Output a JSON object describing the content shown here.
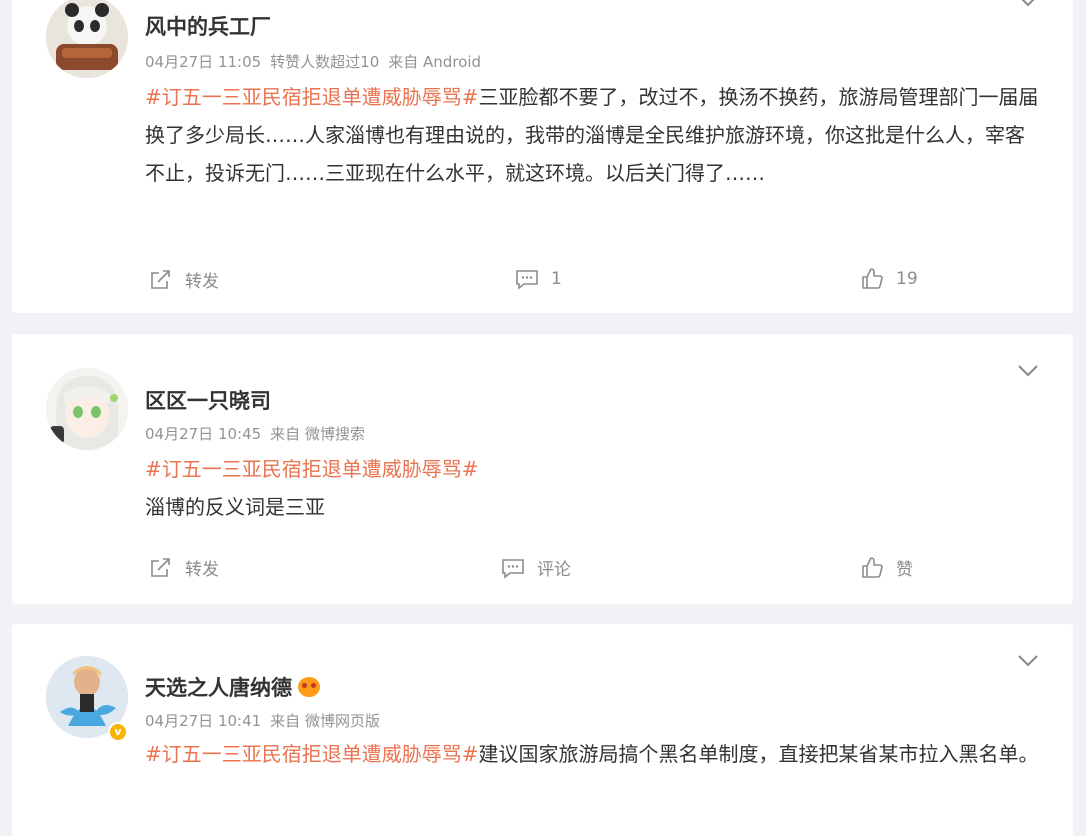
{
  "posts": [
    {
      "user": "风中的兵工厂",
      "date": "04月27日 11:05",
      "extra": "转赞人数超过10",
      "source": "来自 Android",
      "hashtag": "#订五一三亚民宿拒退单遭威胁辱骂#",
      "text": "三亚脸都不要了，改过不，换汤不换药，旅游局管理部门一届届换了多少局长……人家淄博也有理由说的，我带的淄博是全民维护旅游环境，你这批是什么人，宰客不止，投诉无门……三亚现在什么水平，就这环境。以后关门得了……",
      "repost_label": "转发",
      "comment_label": "1",
      "like_label": "19"
    },
    {
      "user": "区区一只晓司",
      "date": "04月27日 10:45",
      "source": "来自 微博搜索",
      "hashtag": "#订五一三亚民宿拒退单遭威胁辱骂#",
      "text": "淄博的反义词是三亚",
      "repost_label": "转发",
      "comment_label": "评论",
      "like_label": "赞"
    },
    {
      "user": "天选之人唐纳德",
      "date": "04月27日 10:41",
      "source": "来自 微博网页版",
      "hashtag": "#订五一三亚民宿拒退单遭威胁辱骂#",
      "text": "建议国家旅游局搞个黑名单制度，直接把某省某市拉入黑名单。",
      "verified": true
    }
  ],
  "icons": {
    "repost": "repost-icon",
    "comment": "comment-icon",
    "like": "thumbs-up-icon",
    "more": "chevron-down-icon"
  },
  "colors": {
    "hashtag": "#eb7350",
    "meta": "#939393",
    "action": "#8c8c8c",
    "background": "#f1f2f5",
    "verified": "#f7b500"
  }
}
